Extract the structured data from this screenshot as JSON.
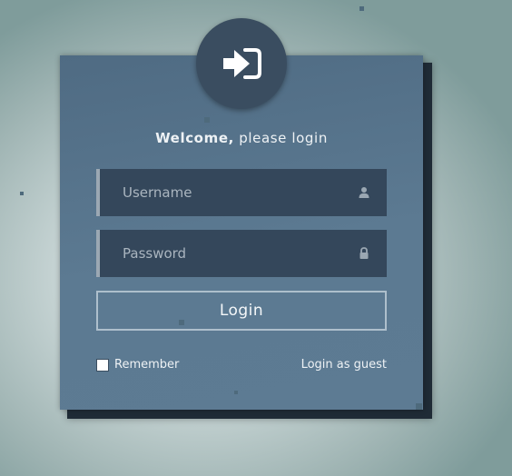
{
  "welcome": {
    "strong": "Welcome,",
    "rest": " please login"
  },
  "username": {
    "placeholder": "Username",
    "icon": "user-icon"
  },
  "password": {
    "placeholder": "Password",
    "icon": "lock-icon"
  },
  "login_button": "Login",
  "remember_label": "Remember",
  "guest_link": "Login as guest",
  "header_icon": "sign-in-icon",
  "colors": {
    "card": "#5a7890",
    "field": "#34475b",
    "circle": "#3a4d60",
    "accent_border": "#9ba8b3"
  }
}
